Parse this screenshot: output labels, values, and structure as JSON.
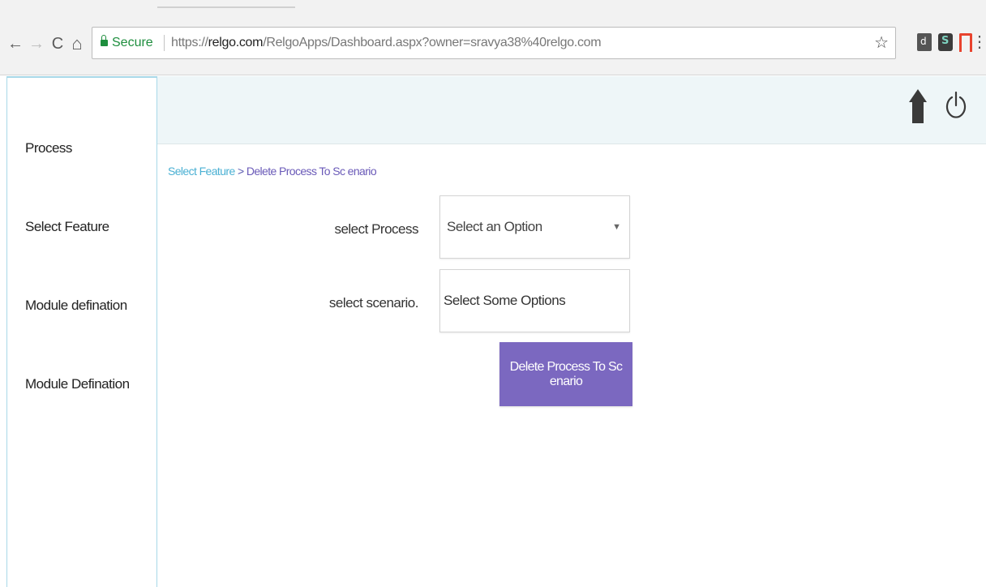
{
  "browser": {
    "secure_label": "Secure",
    "url_scheme": "https://",
    "url_host": "relgo.com",
    "url_path": "/RelgoApps/Dashboard.aspx?owner=sravya38%40relgo.com",
    "nav": {
      "back": "←",
      "forward": "→",
      "reload": "C",
      "home": "⌂"
    },
    "star": "☆",
    "menu": "⋮"
  },
  "sidebar": {
    "items": [
      {
        "label": "Process"
      },
      {
        "label": "Select Feature"
      },
      {
        "label": "Module defination"
      },
      {
        "label": "Module Defination"
      }
    ]
  },
  "topbar": {
    "icons": [
      "home-icon",
      "power-icon"
    ]
  },
  "breadcrumb": {
    "parent": "Select Feature",
    "separator": " > ",
    "current": "Delete Process To Sc enario"
  },
  "form": {
    "process": {
      "label": "select Process",
      "value": "Select an Option",
      "caret": "▼"
    },
    "scenario": {
      "label": "select scenario.",
      "placeholder": "Select Some Options"
    },
    "submit_label": "Delete Process To Sc enario"
  },
  "colors": {
    "accent_button": "#7b68c0",
    "link": "#4ab0d3",
    "secure_green": "#1e8e3e",
    "topbar_bg": "#eef6f8"
  }
}
